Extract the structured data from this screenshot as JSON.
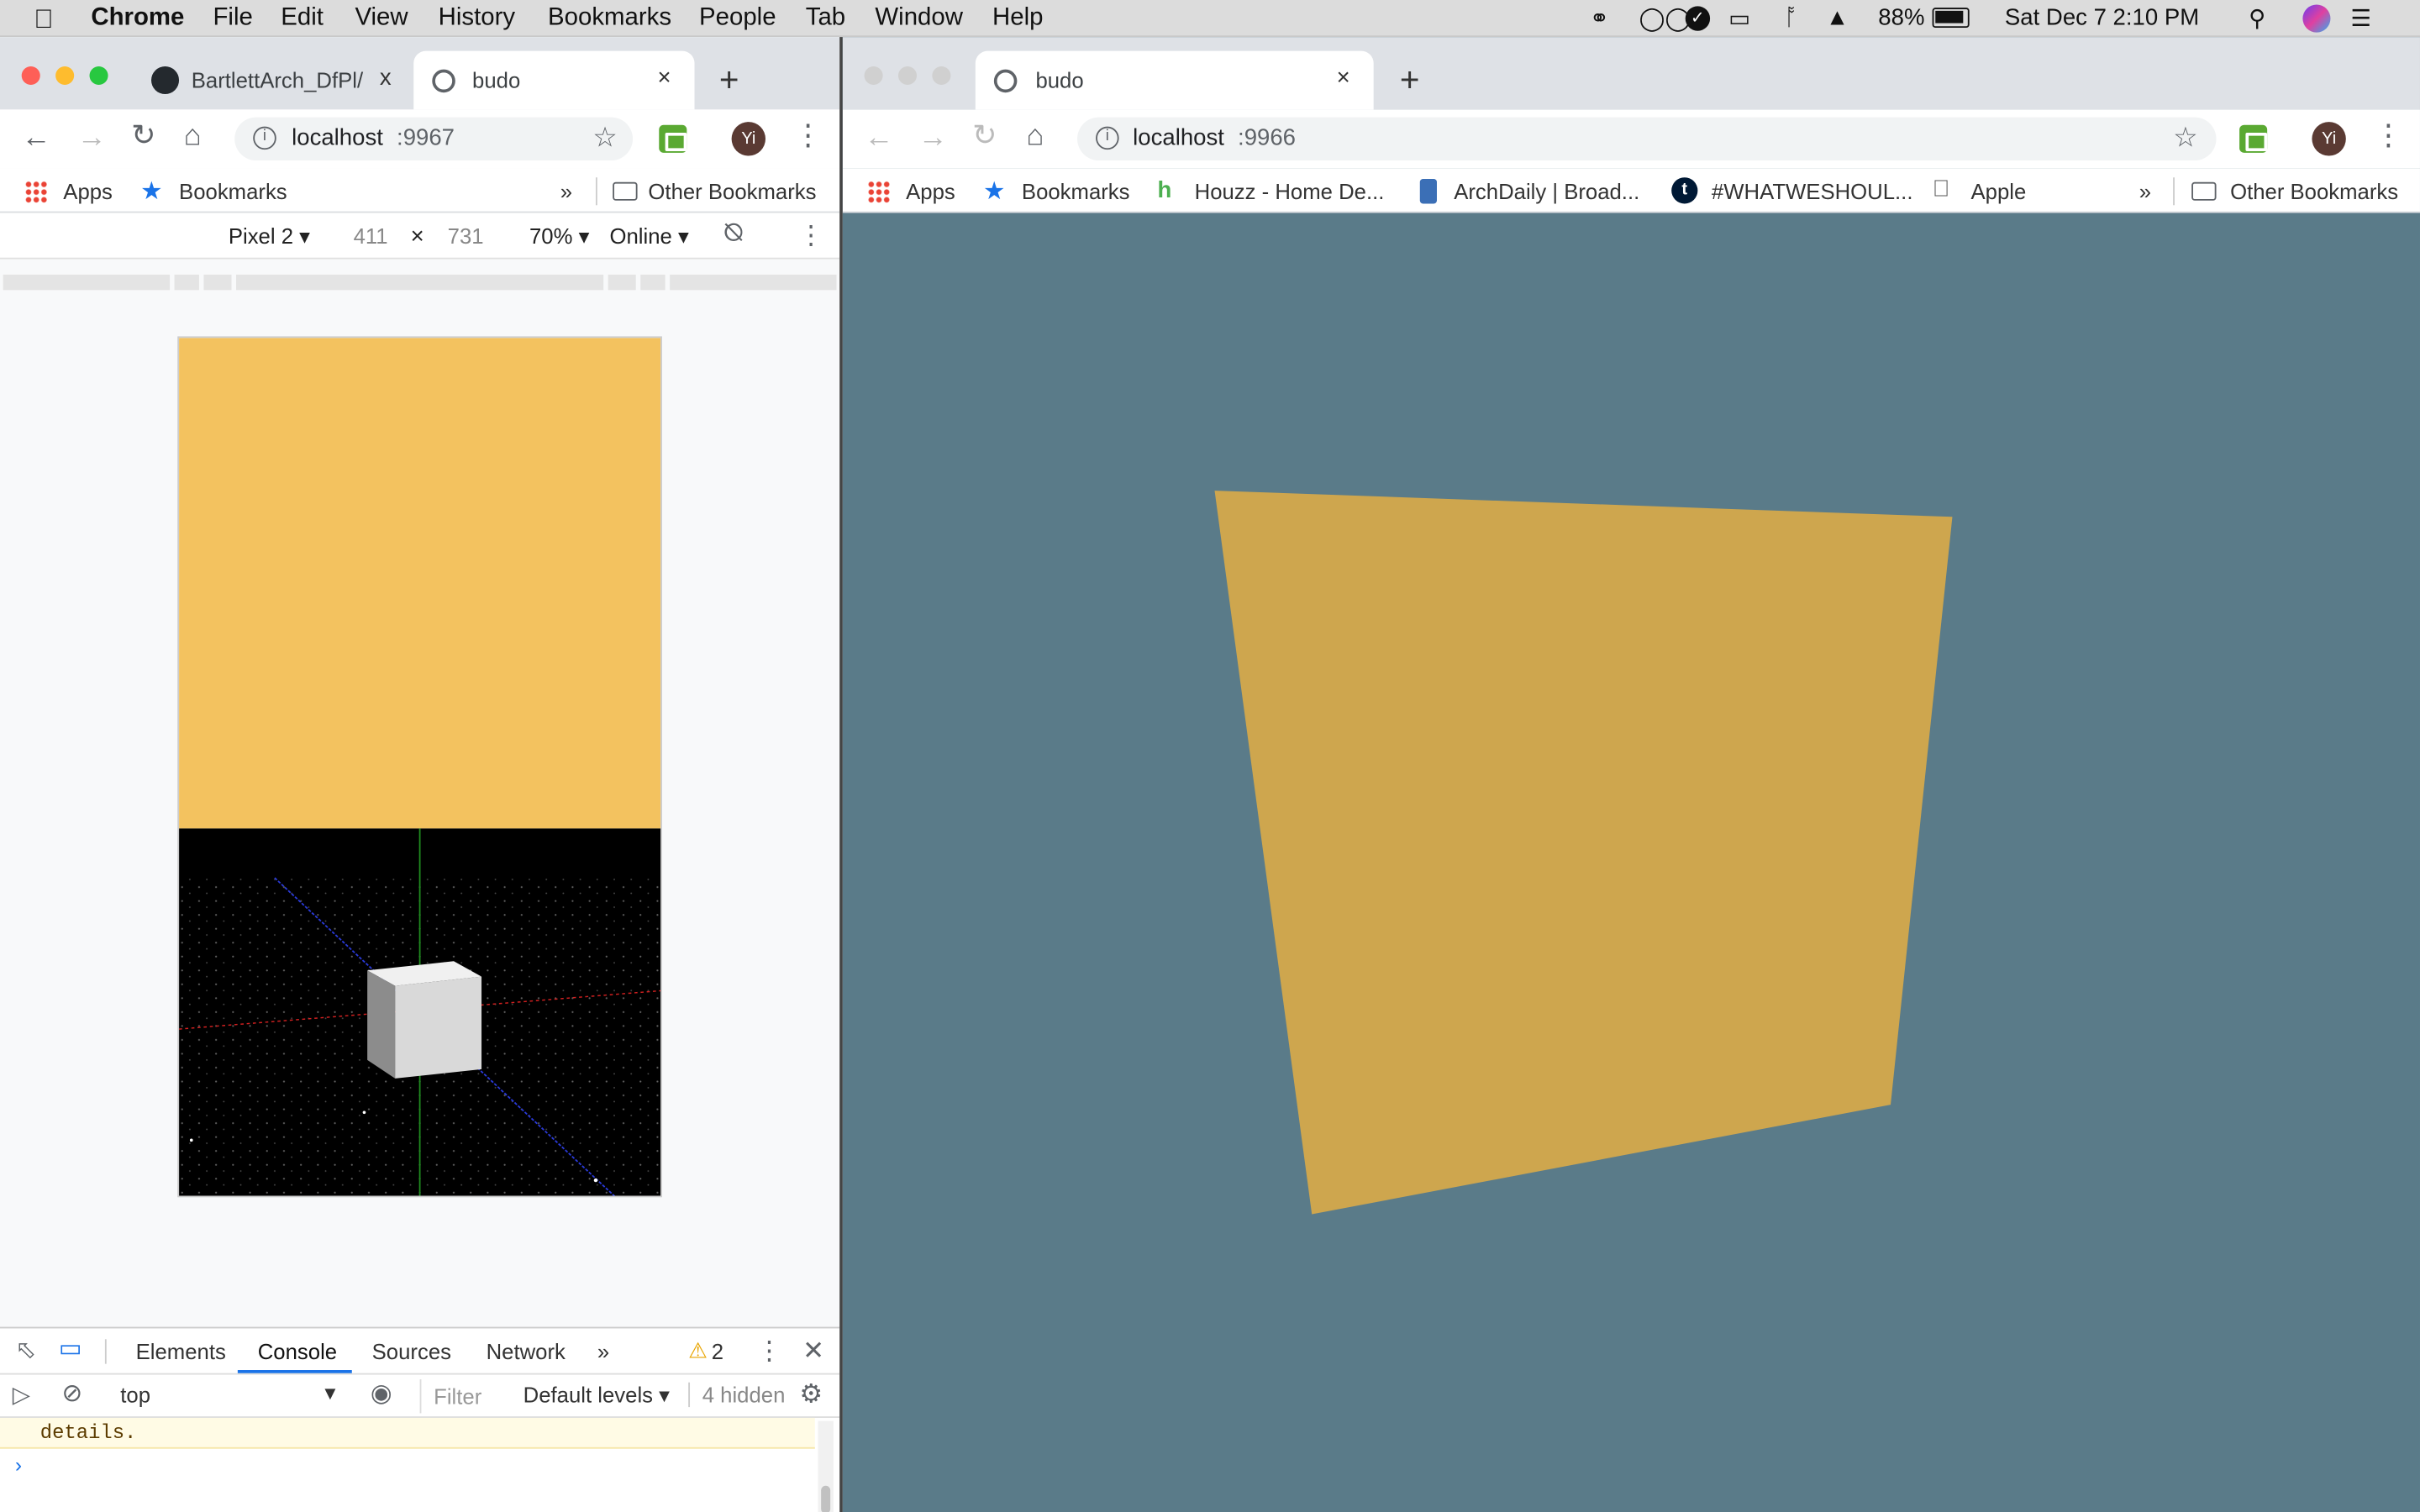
{
  "menubar": {
    "app": "Chrome",
    "items": [
      "File",
      "Edit",
      "View",
      "History",
      "Bookmarks",
      "People",
      "Tab",
      "Window",
      "Help"
    ],
    "battery": "88%",
    "datetime": "Sat Dec 7  2:10 PM"
  },
  "left_window": {
    "tabs": [
      {
        "title": "BartlettArch_DfPl/",
        "close": "x"
      },
      {
        "title": "budo",
        "close": "×"
      }
    ],
    "url_host": "localhost",
    "url_port": ":9967",
    "avatar": "Yi",
    "bookmarks": {
      "apps": "Apps",
      "bookmarks": "Bookmarks",
      "more": "»",
      "other": "Other Bookmarks"
    },
    "device": {
      "name": "Pixel 2",
      "width": "411",
      "times": "×",
      "height": "731",
      "zoom": "70%",
      "network": "Online"
    },
    "devtools": {
      "tabs": [
        "Elements",
        "Console",
        "Sources",
        "Network"
      ],
      "more": "»",
      "active_tab": "Console",
      "warnings": "2",
      "context": "top",
      "filter_placeholder": "Filter",
      "levels": "Default levels",
      "hidden": "4 hidden",
      "message": "details.",
      "prompt": "›"
    },
    "colors": {
      "phone_top": "#f3c25f",
      "phone_bottom": "#000000",
      "cube": "#d9d9d9"
    }
  },
  "right_window": {
    "tab": {
      "title": "budo",
      "close": "×"
    },
    "url_host": "localhost",
    "url_port": ":9966",
    "avatar": "Yi",
    "bookmarks": {
      "items": [
        "Apps",
        "Bookmarks",
        "Houzz - Home De...",
        "ArchDaily | Broad...",
        "#WHATWESHOUL...",
        "Apple"
      ],
      "more": "»",
      "other": "Other Bookmarks"
    },
    "colors": {
      "background": "#5a7b89",
      "quad": "#cea64e"
    }
  }
}
